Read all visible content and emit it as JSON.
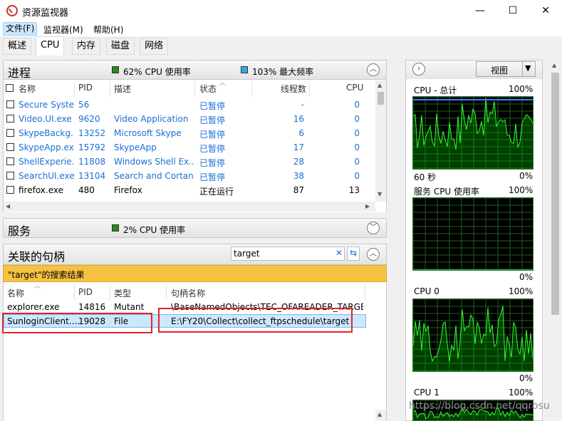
{
  "window": {
    "title": "资源监视器",
    "minimize": "—",
    "maximize": "☐",
    "close": "✕"
  },
  "menu": [
    "文件(F)",
    "监视器(M)",
    "帮助(H)"
  ],
  "tabs": [
    "概述",
    "CPU",
    "内存",
    "磁盘",
    "网络"
  ],
  "processes": {
    "title": "进程",
    "cpu_usage": "62% CPU 使用率",
    "max_freq": "103% 最大频率",
    "columns": [
      "名称",
      "PID",
      "描述",
      "状态",
      "线程数",
      "CPU"
    ],
    "rows": [
      {
        "name": "Secure Syste...",
        "pid": "56",
        "desc": "",
        "status": "已暂停",
        "threads": "-",
        "cpu": "0",
        "suspended": true
      },
      {
        "name": "Video.UI.exe",
        "pid": "9620",
        "desc": "Video Application",
        "status": "已暂停",
        "threads": "16",
        "cpu": "0",
        "suspended": true
      },
      {
        "name": "SkypeBackg...",
        "pid": "13252",
        "desc": "Microsoft Skype",
        "status": "已暂停",
        "threads": "6",
        "cpu": "0",
        "suspended": true
      },
      {
        "name": "SkypeApp.exe",
        "pid": "15792",
        "desc": "SkypeApp",
        "status": "已暂停",
        "threads": "17",
        "cpu": "0",
        "suspended": true
      },
      {
        "name": "ShellExperie...",
        "pid": "11808",
        "desc": "Windows Shell Ex...",
        "status": "已暂停",
        "threads": "28",
        "cpu": "0",
        "suspended": true
      },
      {
        "name": "SearchUI.exe",
        "pid": "13104",
        "desc": "Search and Cortan...",
        "status": "已暂停",
        "threads": "38",
        "cpu": "0",
        "suspended": true
      },
      {
        "name": "firefox.exe",
        "pid": "480",
        "desc": "Firefox",
        "status": "正在运行",
        "threads": "87",
        "cpu": "13",
        "suspended": false
      }
    ]
  },
  "services": {
    "title": "服务",
    "cpu_usage": "2% CPU 使用率"
  },
  "handles": {
    "title": "关联的句柄",
    "search_value": "target",
    "result_label": "\"target\"的搜索结果",
    "columns": [
      "名称",
      "PID",
      "类型",
      "句柄名称"
    ],
    "rows": [
      {
        "name": "explorer.exe",
        "pid": "14816",
        "type": "Mutant",
        "handle": "\\BaseNamedObjects\\TEC_OFAREADER_TARGET_..."
      },
      {
        "name": "SunloginClient....",
        "pid": "19028",
        "type": "File",
        "handle": "E:\\FY20\\Collect\\collect_ftpschedule\\target"
      }
    ]
  },
  "right": {
    "view_label": "视图",
    "graphs": [
      {
        "title": "CPU - 总计",
        "max": "100%",
        "min_left": "60 秒",
        "min_right": "0%"
      },
      {
        "title": "服务 CPU 使用率",
        "max": "100%",
        "min_left": "",
        "min_right": "0%"
      },
      {
        "title": "CPU 0",
        "max": "100%",
        "min_left": "",
        "min_right": "0%"
      },
      {
        "title": "CPU 1",
        "max": "100%",
        "min_left": "",
        "min_right": ""
      }
    ]
  },
  "watermark": "https://blog.csdn.net/qqrosu"
}
